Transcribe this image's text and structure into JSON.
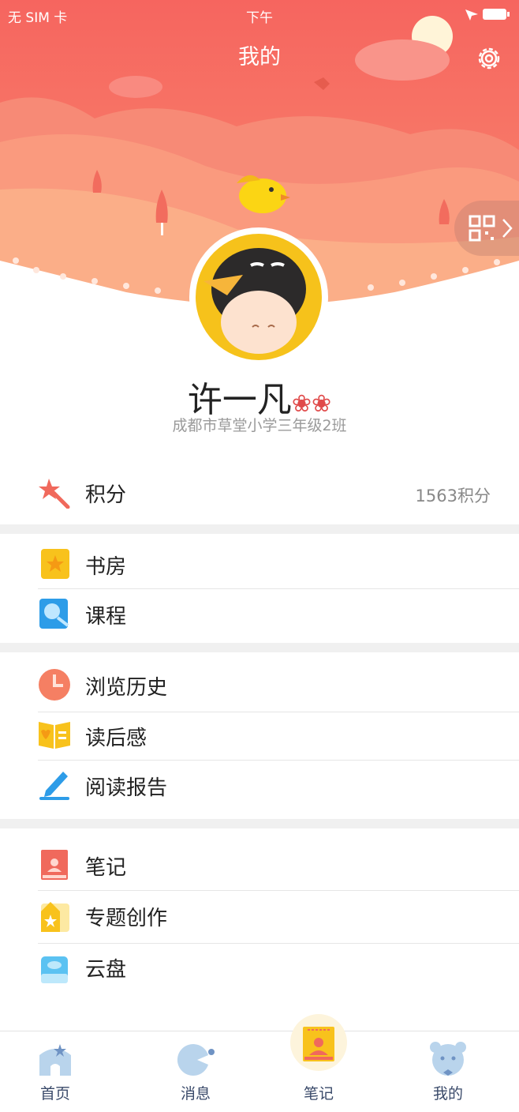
{
  "status_bar": {
    "carrier": "无 SIM 卡",
    "time": "下午"
  },
  "header": {
    "title": "我的"
  },
  "profile": {
    "name": "许一凡",
    "badge": "❀❀",
    "school": "成都市草堂小学三年级2班"
  },
  "points": {
    "label": "积分",
    "value": "1563积分"
  },
  "group1": [
    {
      "label": "书房"
    },
    {
      "label": "课程"
    }
  ],
  "group2": [
    {
      "label": "浏览历史"
    },
    {
      "label": "读后感"
    },
    {
      "label": "阅读报告"
    }
  ],
  "group3": [
    {
      "label": "笔记"
    },
    {
      "label": "专题创作"
    },
    {
      "label": "云盘"
    }
  ],
  "tabs": [
    {
      "label": "首页"
    },
    {
      "label": "消息"
    },
    {
      "label": "笔记"
    },
    {
      "label": "我的"
    }
  ],
  "colors": {
    "header_top": "#f7756a",
    "header_hill": "#f9a07c",
    "accent_yellow": "#f6c21b",
    "accent_blue": "#2d9ce8"
  }
}
